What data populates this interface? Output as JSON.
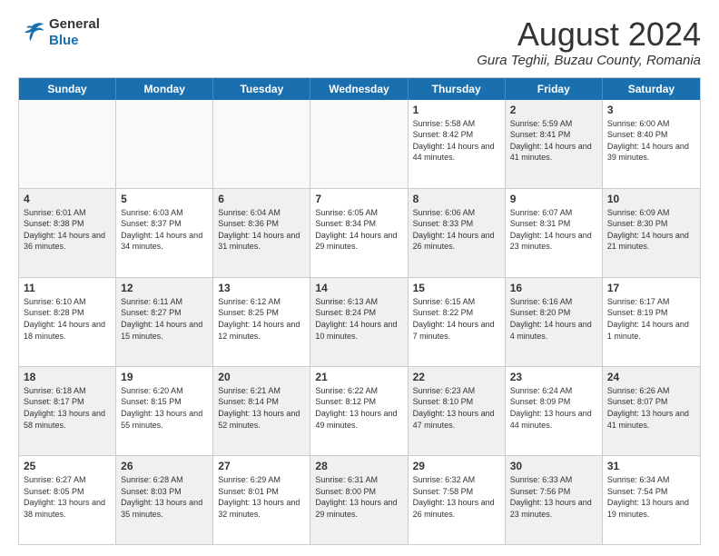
{
  "logo": {
    "line1": "General",
    "line2": "Blue"
  },
  "title": "August 2024",
  "subtitle": "Gura Teghii, Buzau County, Romania",
  "days": [
    "Sunday",
    "Monday",
    "Tuesday",
    "Wednesday",
    "Thursday",
    "Friday",
    "Saturday"
  ],
  "rows": [
    [
      {
        "num": "",
        "sunrise": "",
        "sunset": "",
        "daylight": "",
        "shaded": false,
        "empty": true
      },
      {
        "num": "",
        "sunrise": "",
        "sunset": "",
        "daylight": "",
        "shaded": false,
        "empty": true
      },
      {
        "num": "",
        "sunrise": "",
        "sunset": "",
        "daylight": "",
        "shaded": false,
        "empty": true
      },
      {
        "num": "",
        "sunrise": "",
        "sunset": "",
        "daylight": "",
        "shaded": false,
        "empty": true
      },
      {
        "num": "1",
        "sunrise": "Sunrise: 5:58 AM",
        "sunset": "Sunset: 8:42 PM",
        "daylight": "Daylight: 14 hours and 44 minutes.",
        "shaded": false
      },
      {
        "num": "2",
        "sunrise": "Sunrise: 5:59 AM",
        "sunset": "Sunset: 8:41 PM",
        "daylight": "Daylight: 14 hours and 41 minutes.",
        "shaded": true
      },
      {
        "num": "3",
        "sunrise": "Sunrise: 6:00 AM",
        "sunset": "Sunset: 8:40 PM",
        "daylight": "Daylight: 14 hours and 39 minutes.",
        "shaded": false
      }
    ],
    [
      {
        "num": "4",
        "sunrise": "Sunrise: 6:01 AM",
        "sunset": "Sunset: 8:38 PM",
        "daylight": "Daylight: 14 hours and 36 minutes.",
        "shaded": true
      },
      {
        "num": "5",
        "sunrise": "Sunrise: 6:03 AM",
        "sunset": "Sunset: 8:37 PM",
        "daylight": "Daylight: 14 hours and 34 minutes.",
        "shaded": false
      },
      {
        "num": "6",
        "sunrise": "Sunrise: 6:04 AM",
        "sunset": "Sunset: 8:36 PM",
        "daylight": "Daylight: 14 hours and 31 minutes.",
        "shaded": true
      },
      {
        "num": "7",
        "sunrise": "Sunrise: 6:05 AM",
        "sunset": "Sunset: 8:34 PM",
        "daylight": "Daylight: 14 hours and 29 minutes.",
        "shaded": false
      },
      {
        "num": "8",
        "sunrise": "Sunrise: 6:06 AM",
        "sunset": "Sunset: 8:33 PM",
        "daylight": "Daylight: 14 hours and 26 minutes.",
        "shaded": true
      },
      {
        "num": "9",
        "sunrise": "Sunrise: 6:07 AM",
        "sunset": "Sunset: 8:31 PM",
        "daylight": "Daylight: 14 hours and 23 minutes.",
        "shaded": false
      },
      {
        "num": "10",
        "sunrise": "Sunrise: 6:09 AM",
        "sunset": "Sunset: 8:30 PM",
        "daylight": "Daylight: 14 hours and 21 minutes.",
        "shaded": true
      }
    ],
    [
      {
        "num": "11",
        "sunrise": "Sunrise: 6:10 AM",
        "sunset": "Sunset: 8:28 PM",
        "daylight": "Daylight: 14 hours and 18 minutes.",
        "shaded": false
      },
      {
        "num": "12",
        "sunrise": "Sunrise: 6:11 AM",
        "sunset": "Sunset: 8:27 PM",
        "daylight": "Daylight: 14 hours and 15 minutes.",
        "shaded": true
      },
      {
        "num": "13",
        "sunrise": "Sunrise: 6:12 AM",
        "sunset": "Sunset: 8:25 PM",
        "daylight": "Daylight: 14 hours and 12 minutes.",
        "shaded": false
      },
      {
        "num": "14",
        "sunrise": "Sunrise: 6:13 AM",
        "sunset": "Sunset: 8:24 PM",
        "daylight": "Daylight: 14 hours and 10 minutes.",
        "shaded": true
      },
      {
        "num": "15",
        "sunrise": "Sunrise: 6:15 AM",
        "sunset": "Sunset: 8:22 PM",
        "daylight": "Daylight: 14 hours and 7 minutes.",
        "shaded": false
      },
      {
        "num": "16",
        "sunrise": "Sunrise: 6:16 AM",
        "sunset": "Sunset: 8:20 PM",
        "daylight": "Daylight: 14 hours and 4 minutes.",
        "shaded": true
      },
      {
        "num": "17",
        "sunrise": "Sunrise: 6:17 AM",
        "sunset": "Sunset: 8:19 PM",
        "daylight": "Daylight: 14 hours and 1 minute.",
        "shaded": false
      }
    ],
    [
      {
        "num": "18",
        "sunrise": "Sunrise: 6:18 AM",
        "sunset": "Sunset: 8:17 PM",
        "daylight": "Daylight: 13 hours and 58 minutes.",
        "shaded": true
      },
      {
        "num": "19",
        "sunrise": "Sunrise: 6:20 AM",
        "sunset": "Sunset: 8:15 PM",
        "daylight": "Daylight: 13 hours and 55 minutes.",
        "shaded": false
      },
      {
        "num": "20",
        "sunrise": "Sunrise: 6:21 AM",
        "sunset": "Sunset: 8:14 PM",
        "daylight": "Daylight: 13 hours and 52 minutes.",
        "shaded": true
      },
      {
        "num": "21",
        "sunrise": "Sunrise: 6:22 AM",
        "sunset": "Sunset: 8:12 PM",
        "daylight": "Daylight: 13 hours and 49 minutes.",
        "shaded": false
      },
      {
        "num": "22",
        "sunrise": "Sunrise: 6:23 AM",
        "sunset": "Sunset: 8:10 PM",
        "daylight": "Daylight: 13 hours and 47 minutes.",
        "shaded": true
      },
      {
        "num": "23",
        "sunrise": "Sunrise: 6:24 AM",
        "sunset": "Sunset: 8:09 PM",
        "daylight": "Daylight: 13 hours and 44 minutes.",
        "shaded": false
      },
      {
        "num": "24",
        "sunrise": "Sunrise: 6:26 AM",
        "sunset": "Sunset: 8:07 PM",
        "daylight": "Daylight: 13 hours and 41 minutes.",
        "shaded": true
      }
    ],
    [
      {
        "num": "25",
        "sunrise": "Sunrise: 6:27 AM",
        "sunset": "Sunset: 8:05 PM",
        "daylight": "Daylight: 13 hours and 38 minutes.",
        "shaded": false
      },
      {
        "num": "26",
        "sunrise": "Sunrise: 6:28 AM",
        "sunset": "Sunset: 8:03 PM",
        "daylight": "Daylight: 13 hours and 35 minutes.",
        "shaded": true
      },
      {
        "num": "27",
        "sunrise": "Sunrise: 6:29 AM",
        "sunset": "Sunset: 8:01 PM",
        "daylight": "Daylight: 13 hours and 32 minutes.",
        "shaded": false
      },
      {
        "num": "28",
        "sunrise": "Sunrise: 6:31 AM",
        "sunset": "Sunset: 8:00 PM",
        "daylight": "Daylight: 13 hours and 29 minutes.",
        "shaded": true
      },
      {
        "num": "29",
        "sunrise": "Sunrise: 6:32 AM",
        "sunset": "Sunset: 7:58 PM",
        "daylight": "Daylight: 13 hours and 26 minutes.",
        "shaded": false
      },
      {
        "num": "30",
        "sunrise": "Sunrise: 6:33 AM",
        "sunset": "Sunset: 7:56 PM",
        "daylight": "Daylight: 13 hours and 23 minutes.",
        "shaded": true
      },
      {
        "num": "31",
        "sunrise": "Sunrise: 6:34 AM",
        "sunset": "Sunset: 7:54 PM",
        "daylight": "Daylight: 13 hours and 19 minutes.",
        "shaded": false
      }
    ]
  ]
}
